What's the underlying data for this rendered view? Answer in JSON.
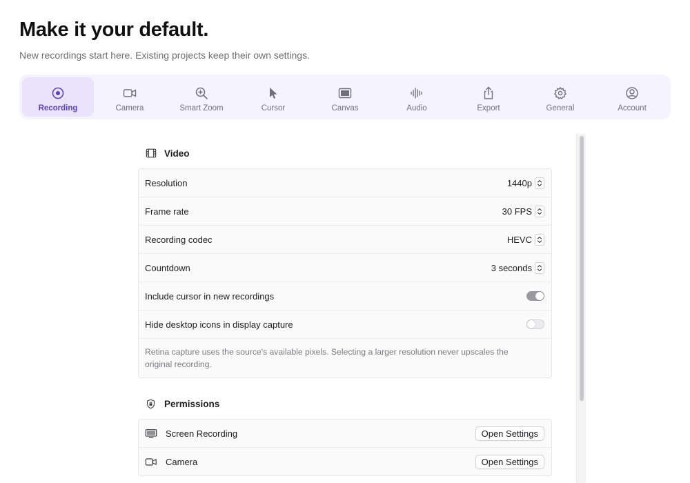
{
  "header": {
    "title": "Make it your default.",
    "subtitle": "New recordings start here. Existing projects keep their own settings."
  },
  "tabs": [
    {
      "label": "Recording",
      "icon": "record-icon",
      "active": true
    },
    {
      "label": "Camera",
      "icon": "camera-icon"
    },
    {
      "label": "Smart Zoom",
      "icon": "zoom-icon"
    },
    {
      "label": "Cursor",
      "icon": "cursor-icon"
    },
    {
      "label": "Canvas",
      "icon": "canvas-icon"
    },
    {
      "label": "Audio",
      "icon": "audio-waveform-icon"
    },
    {
      "label": "Export",
      "icon": "share-icon"
    },
    {
      "label": "General",
      "icon": "gear-icon"
    },
    {
      "label": "Account",
      "icon": "account-icon"
    }
  ],
  "video": {
    "title": "Video",
    "rows": [
      {
        "label": "Resolution",
        "value": "1440p"
      },
      {
        "label": "Frame rate",
        "value": "30 FPS"
      },
      {
        "label": "Recording codec",
        "value": "HEVC"
      },
      {
        "label": "Countdown",
        "value": "3 seconds"
      }
    ],
    "toggles": [
      {
        "label": "Include cursor in new recordings",
        "on": true
      },
      {
        "label": "Hide desktop icons in display capture",
        "on": false
      }
    ],
    "note": "Retina capture uses the source's available pixels. Selecting a larger resolution never upscales the original recording."
  },
  "permissions": {
    "title": "Permissions",
    "items": [
      {
        "label": "Screen Recording",
        "icon": "display-icon",
        "button": "Open Settings"
      },
      {
        "label": "Camera",
        "icon": "camera-icon",
        "button": "Open Settings"
      }
    ]
  },
  "colors": {
    "accent": "#5b3fc0",
    "tabbar_bg": "#f5f3fd",
    "tab_active_bg": "#e9e3fb"
  }
}
